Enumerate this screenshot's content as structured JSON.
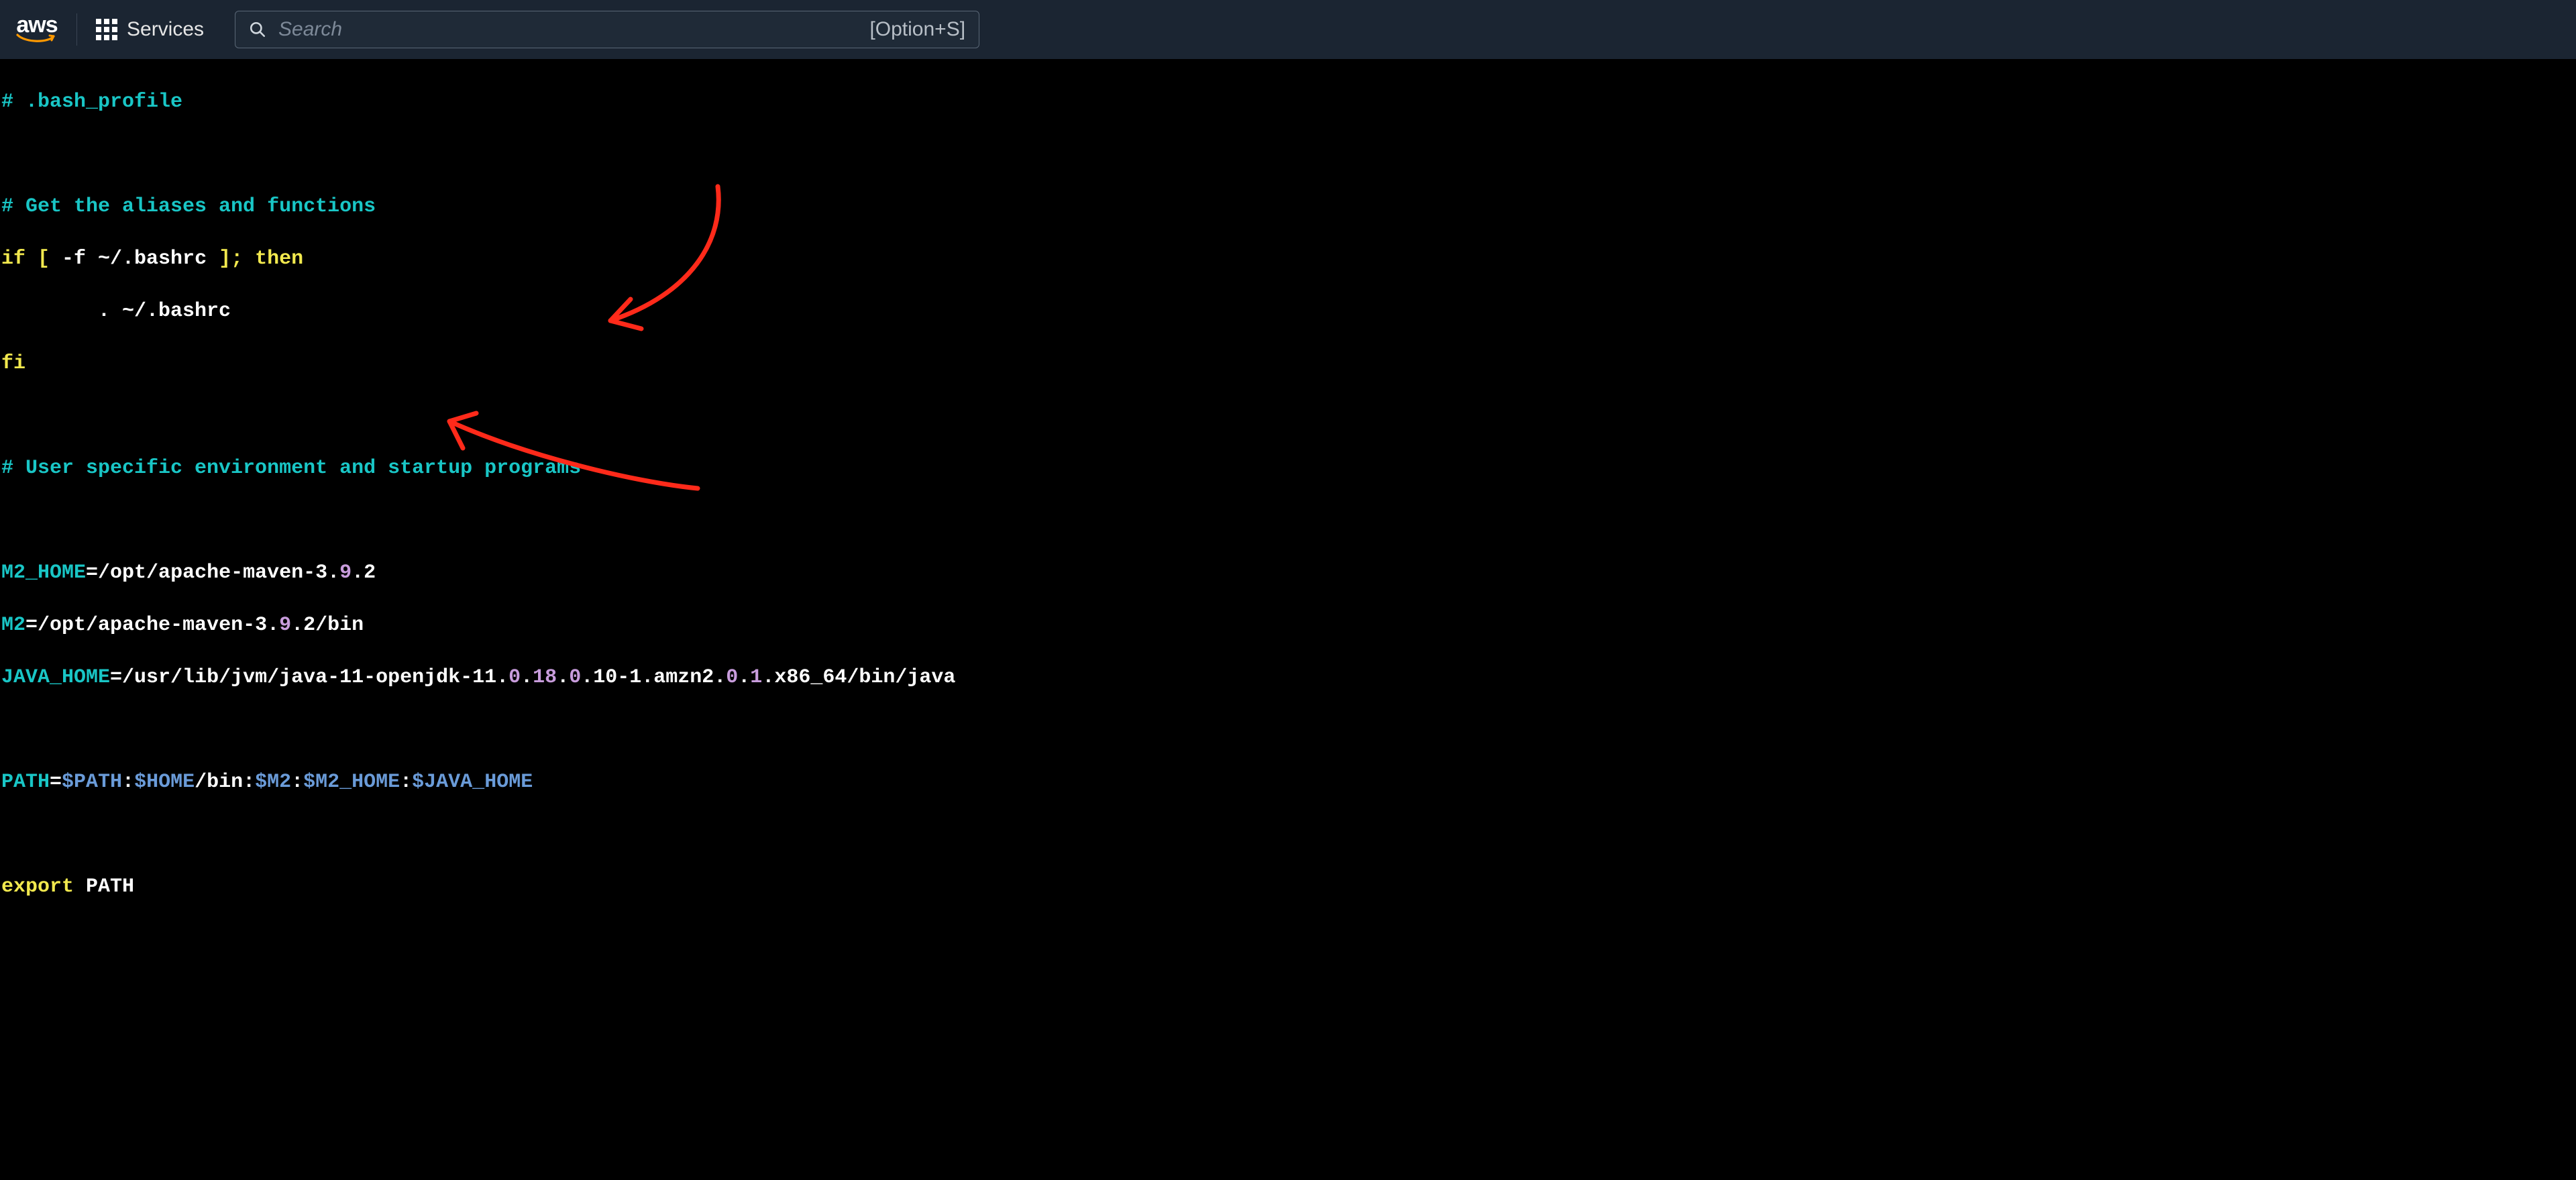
{
  "header": {
    "logo_text": "aws",
    "services_label": "Services",
    "search_placeholder": "Search",
    "search_hint": "[Option+S]"
  },
  "code": {
    "l1_comment": "# .bash_profile",
    "l2_comment": "# Get the aliases and functions",
    "l3_if": "if",
    "l3_lb": " [ ",
    "l3_cond": "-f ~/.bashrc",
    "l3_rb": " ];",
    "l3_then": " then",
    "l4_body": "        . ~/.bashrc",
    "l5_fi": "fi",
    "l6_comment": "# User specific environment and startup programs",
    "m2home_key": "M2_HOME",
    "m2home_eq": "=",
    "m2home_val_a": "/opt/apache-maven-3.",
    "m2home_val_b": "9",
    "m2home_val_c": ".2",
    "m2_key": "M2",
    "m2_eq": "=",
    "m2_val_a": "/opt/apache-maven-3.",
    "m2_val_b": "9",
    "m2_val_c": ".2",
    "m2_val_d": "/bin",
    "jh_key": "JAVA_HOME",
    "jh_eq": "=",
    "jh_a": "/usr/lib/jvm/java-11-openjdk-11.",
    "jh_b": "0",
    "jh_c": ".",
    "jh_d": "18",
    "jh_e": ".",
    "jh_f": "0",
    "jh_g": ".10-1.amzn2.",
    "jh_h": "0",
    "jh_i": ".",
    "jh_j": "1",
    "jh_k": ".x86_64/bin/java",
    "path_key": "PATH",
    "path_eq": "=",
    "path_v1": "$PATH",
    "path_s1": ":",
    "path_v2": "$HOME",
    "path_p1": "/bin:",
    "path_v3": "$M2",
    "path_s2": ":",
    "path_v4": "$M2_HOME",
    "path_s3": ":",
    "path_v5": "$JAVA_HOME",
    "export_kw": "export",
    "export_sp": " ",
    "export_var": "PATH"
  }
}
